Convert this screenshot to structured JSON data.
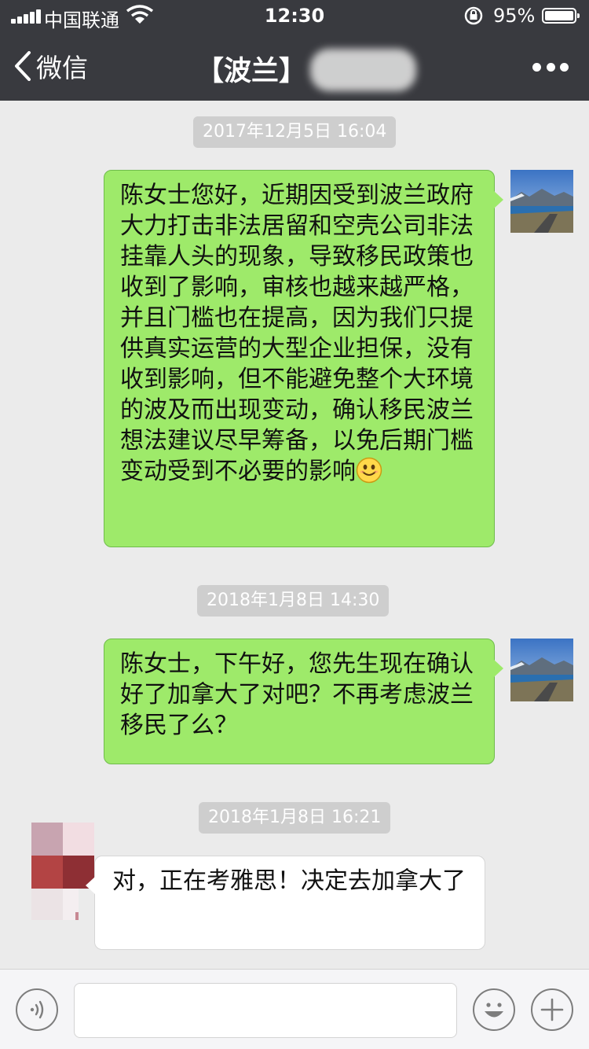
{
  "status_bar": {
    "carrier": "中国联通",
    "time": "12:30",
    "battery": "95%"
  },
  "nav": {
    "back_label": "微信",
    "title": "【波兰】"
  },
  "messages": [
    {
      "type": "timestamp",
      "text": "2017年12月5日 16:04"
    },
    {
      "type": "sent",
      "text": "陈女士您好，近期因受到波兰政府大力打击非法居留和空壳公司非法挂靠人头的现象，导致移民政策也收到了影响，审核也越来越严格，并且门槛也在提高，因为我们只提供真实运营的大型企业担保，没有收到影响，但不能避免整个大环境的波及而出现变动，确认移民波兰想法建议尽早筹备，以免后期门槛变动受到不必要的影响",
      "emoji": "smile-emoji"
    },
    {
      "type": "timestamp",
      "text": "2018年1月8日 14:30"
    },
    {
      "type": "sent",
      "text": "陈女士，下午好，您先生现在确认好了加拿大了对吧？不再考虑波兰移民了么？"
    },
    {
      "type": "timestamp",
      "text": "2018年1月8日 16:21"
    },
    {
      "type": "received",
      "text": "对，正在考雅思！决定去加拿大了"
    }
  ],
  "input_bar": {
    "voice_icon": "voice-icon",
    "emoji_icon": "emoji-icon",
    "plus_icon": "plus-icon",
    "text": ""
  },
  "colors": {
    "nav_bg": "#393a3f",
    "chat_bg": "#ebebeb",
    "sent_bubble": "#9eea6a",
    "received_bubble": "#ffffff"
  }
}
